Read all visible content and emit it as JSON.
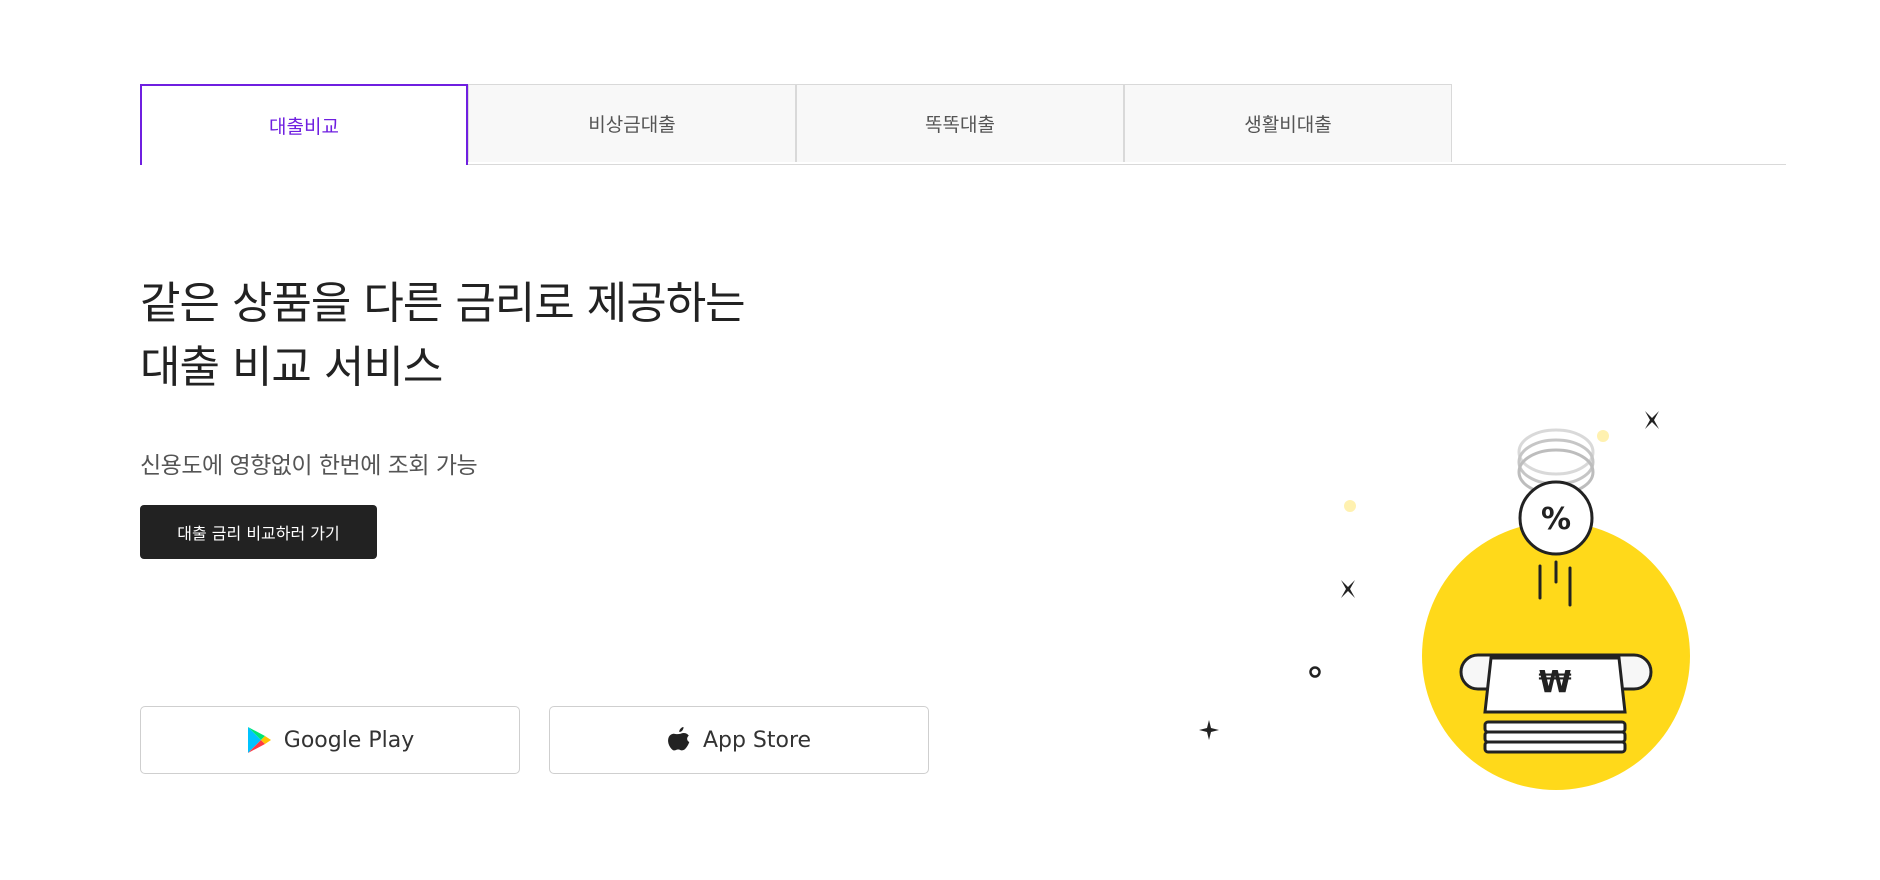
{
  "tabs": [
    {
      "label": "대출비교",
      "active": true
    },
    {
      "label": "비상금대출",
      "active": false
    },
    {
      "label": "똑똑대출",
      "active": false
    },
    {
      "label": "생활비대출",
      "active": false
    }
  ],
  "hero": {
    "headline_line1": "같은 상품을 다른 금리로 제공하는",
    "headline_line2": "대출 비교 서비스",
    "subline": "신용도에 영향없이 한번에 조회 가능",
    "cta_label": "대출 금리 비교하러 가기"
  },
  "stores": {
    "google_label": "Google Play",
    "apple_label": "App Store"
  },
  "illustration": {
    "coin_symbol": "%",
    "bill_symbol": "₩",
    "circle_color": "#FFD91A",
    "accent_color": "#6F1FE0"
  }
}
